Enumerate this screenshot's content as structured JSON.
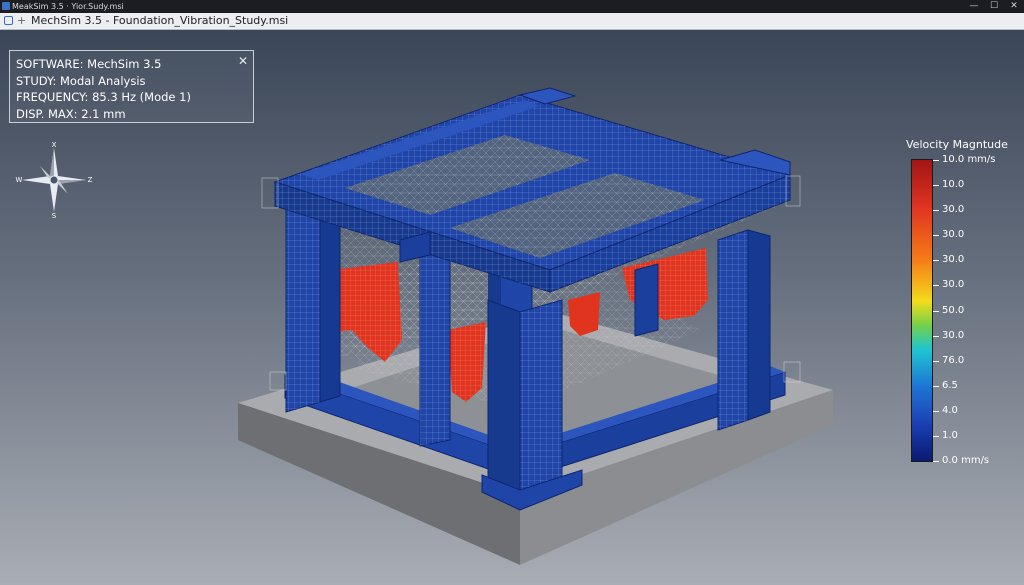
{
  "window": {
    "title": "MeakSim 3.5 · Yior.Sudy.msi",
    "minimize": "—",
    "maximize": "☐",
    "close": "✕"
  },
  "tab": {
    "plus": "+",
    "title": "MechSim 3.5 - Foundation_Vibration_Study.msi"
  },
  "info": {
    "line1": "SOFTWARE: MechSim 3.5",
    "line2": "STUDY: Modal Analysis",
    "line3": "FREQUENCY: 85.3 Hz (Mode 1)",
    "line4": "DISP. MAX: 2.1 mm",
    "close": "✕"
  },
  "compass": {
    "n": "X",
    "w": "W",
    "e": "Z",
    "s": "S"
  },
  "legend": {
    "title": "Velocity Magntude",
    "labels": [
      "10.0 mm/s",
      "10.0",
      "30.0",
      "30.0",
      "30.0",
      "30.0",
      "50.0",
      "30.0",
      "76.0",
      "6.5",
      "4.0",
      "1.0",
      "0.0 mm/s"
    ]
  },
  "colors": {
    "structure": "#1f45a8",
    "hotspot": "#e0341f",
    "slab_top": "#a9abaf",
    "slab_side": "#6d6f73"
  }
}
